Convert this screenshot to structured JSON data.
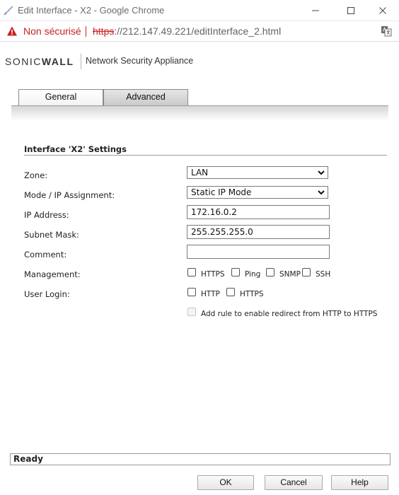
{
  "window": {
    "title": "Edit Interface - X2 - Google Chrome"
  },
  "address_bar": {
    "security_label": "Non sécurisé",
    "url_scheme": "https",
    "url_rest": "://212.147.49.221/editInterface_2.html"
  },
  "brand": {
    "logo_light": "SONIC",
    "logo_bold": "WALL",
    "subtitle": "Network Security Appliance"
  },
  "tabs": [
    {
      "label": "General",
      "active": true
    },
    {
      "label": "Advanced",
      "active": false
    }
  ],
  "section": {
    "title": "Interface 'X2' Settings"
  },
  "form": {
    "zone": {
      "label": "Zone:",
      "value": "LAN"
    },
    "mode": {
      "label": "Mode / IP Assignment:",
      "value": "Static IP Mode"
    },
    "ip_address": {
      "label": "IP Address:",
      "value": "172.16.0.2"
    },
    "subnet_mask": {
      "label": "Subnet Mask:",
      "value": "255.255.255.0"
    },
    "comment": {
      "label": "Comment:",
      "value": ""
    },
    "management": {
      "label": "Management:",
      "options": [
        {
          "label": "HTTPS",
          "checked": false
        },
        {
          "label": "Ping",
          "checked": false
        },
        {
          "label": "SNMP",
          "checked": false
        },
        {
          "label": "SSH",
          "checked": false
        }
      ]
    },
    "user_login": {
      "label": "User Login:",
      "options": [
        {
          "label": "HTTP",
          "checked": false
        },
        {
          "label": "HTTPS",
          "checked": false
        }
      ]
    },
    "redirect_rule": {
      "label": "Add rule to enable redirect from HTTP to HTTPS",
      "checked": false,
      "disabled": true
    }
  },
  "status": {
    "text": "Ready"
  },
  "buttons": {
    "ok": "OK",
    "cancel": "Cancel",
    "help": "Help"
  },
  "colors": {
    "insecure_red": "#c5221f",
    "tab_active": "#f2f2f2",
    "tab_inactive": "#c9c9c9"
  },
  "icons": {
    "app": "chrome-page-icon",
    "warning": "warning-triangle-icon",
    "translate": "translate-icon"
  }
}
